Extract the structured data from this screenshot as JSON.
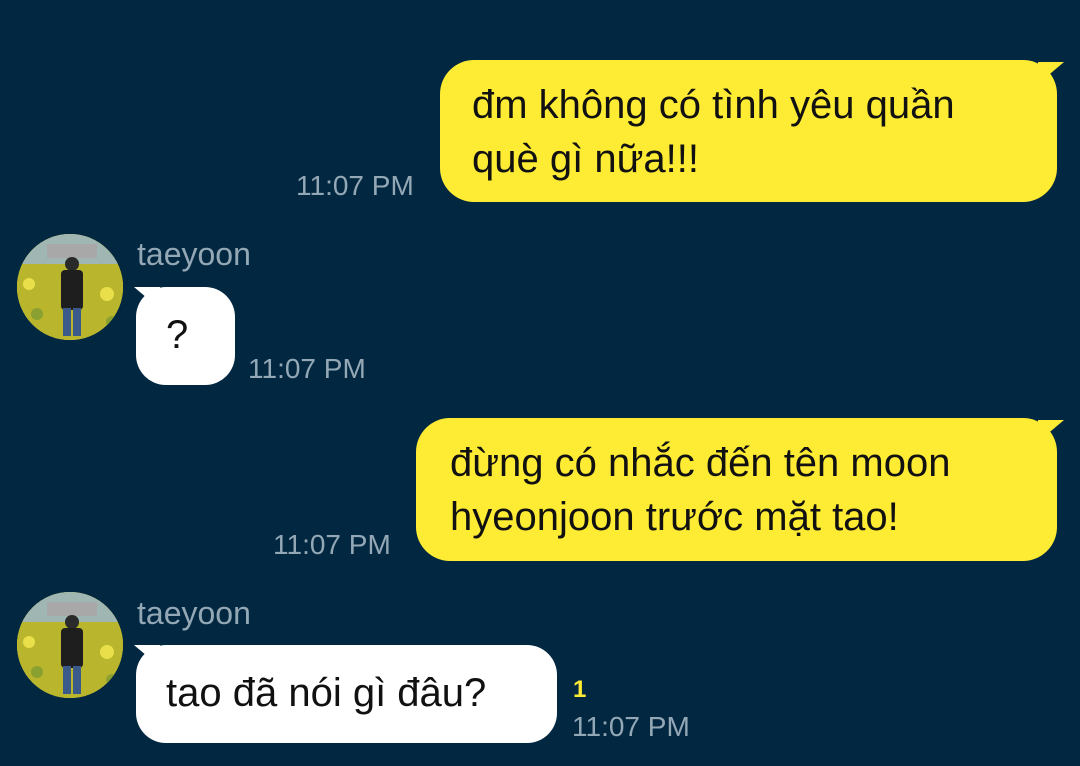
{
  "colors": {
    "background": "#022841",
    "my_bubble": "#FEEB33",
    "their_bubble": "#FFFFFF",
    "timestamp": "#93A7B5",
    "unread_count": "#FEEB33"
  },
  "messages": [
    {
      "from": "me",
      "text_lines": [
        "đm không có tình yêu quần",
        "què gì nữa!!!"
      ],
      "time": "11:07 PM"
    },
    {
      "from": "taeyoon",
      "sender": "taeyoon",
      "avatar_icon": "profile-photo-icon",
      "text": "?",
      "time": "11:07 PM"
    },
    {
      "from": "me",
      "text_lines": [
        "đừng có nhắc đến tên moon",
        "hyeonjoon trước mặt tao!"
      ],
      "time": "11:07 PM"
    },
    {
      "from": "taeyoon",
      "sender": "taeyoon",
      "avatar_icon": "profile-photo-icon",
      "text": "tao đã nói gì đâu?",
      "time": "11:07 PM",
      "unread": "1"
    }
  ]
}
